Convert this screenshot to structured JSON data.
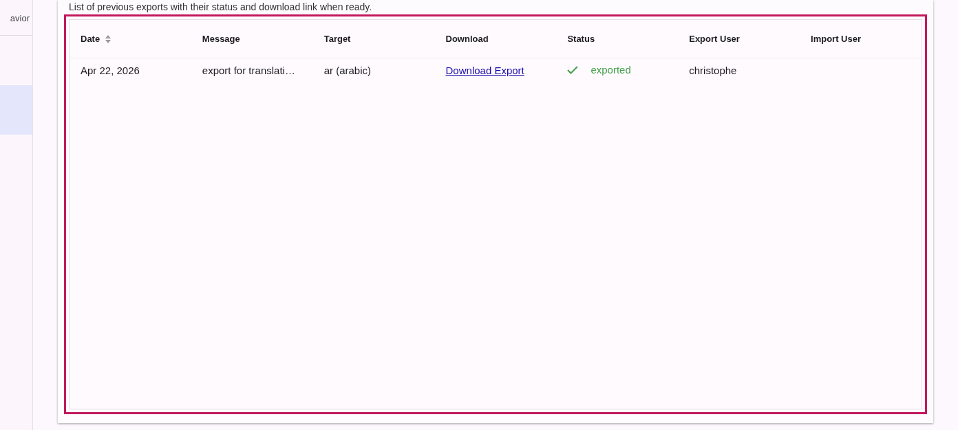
{
  "sidebar": {
    "items": [
      {
        "label": "avior",
        "selected": false
      },
      {
        "selected": true
      }
    ]
  },
  "description": "List of previous exports with their status and download link when ready.",
  "table": {
    "columns": [
      {
        "label": "Date",
        "sortable": true
      },
      {
        "label": "Message",
        "sortable": false
      },
      {
        "label": "Target",
        "sortable": false
      },
      {
        "label": "Download",
        "sortable": false
      },
      {
        "label": "Status",
        "sortable": false
      },
      {
        "label": "Export User",
        "sortable": false
      },
      {
        "label": "Import User",
        "sortable": false
      }
    ],
    "rows": [
      {
        "date": "Apr 22, 2026",
        "message": "export for translati…",
        "target": "ar (arabic)",
        "download": "Download Export",
        "status": {
          "kind": "success",
          "label": "exported"
        },
        "export_user": "christophe"
      }
    ]
  }
}
